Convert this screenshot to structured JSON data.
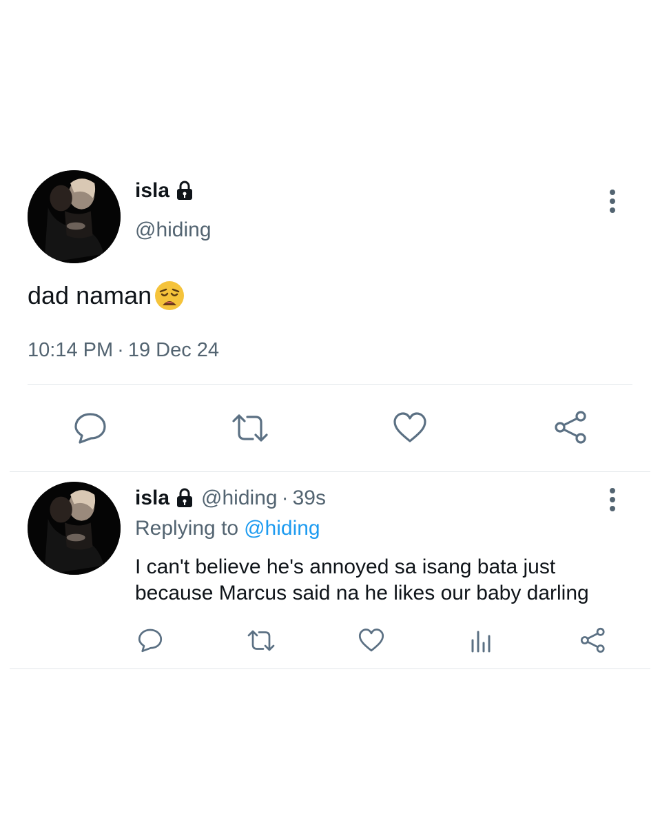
{
  "main_tweet": {
    "display_name": "isla",
    "handle": "@hiding",
    "text": "dad naman",
    "emoji": "weary-face-icon",
    "time": "10:14 PM",
    "date": "19 Dec 24",
    "separator": "·",
    "actions": [
      "reply-icon",
      "retweet-icon",
      "like-icon",
      "share-icon"
    ]
  },
  "reply_tweet": {
    "display_name": "isla",
    "handle": "@hiding",
    "separator": "·",
    "age": "39s",
    "replying_prefix": "Replying to",
    "replying_to": "@hiding",
    "text": "I can't believe he's annoyed sa isang bata just because Marcus said na he likes our baby darling",
    "actions": [
      "reply-icon",
      "retweet-icon",
      "like-icon",
      "analytics-icon",
      "share-icon"
    ]
  },
  "colors": {
    "text_primary": "#0f1419",
    "text_secondary": "#536471",
    "accent": "#1d9bf0",
    "divider": "#e2e6ea",
    "icon": "#5b7083"
  }
}
